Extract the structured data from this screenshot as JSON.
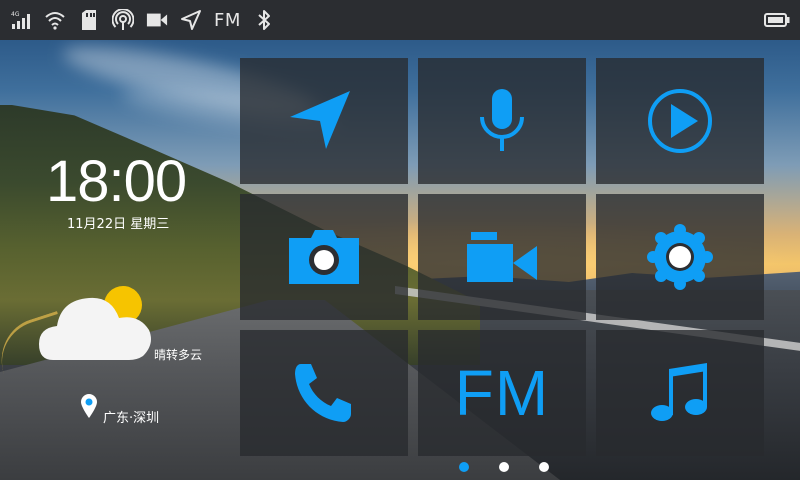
{
  "status_bar": {
    "signal_label": "4G",
    "fm_label": "FM",
    "icons": [
      "signal-4g-icon",
      "wifi-icon",
      "sd-card-icon",
      "hotspot-icon",
      "video-camera-icon",
      "navigation-icon",
      "fm-label",
      "bluetooth-icon",
      "battery-icon"
    ]
  },
  "clock": {
    "time": "18:00",
    "date": "11月22日  星期三"
  },
  "weather": {
    "description": "晴转多云",
    "icon": "partly-cloudy-icon"
  },
  "location": {
    "label": "广东·深圳"
  },
  "tiles": [
    {
      "name": "navigation",
      "icon": "navigation-arrow-icon"
    },
    {
      "name": "voice",
      "icon": "microphone-icon"
    },
    {
      "name": "video-player",
      "icon": "play-icon"
    },
    {
      "name": "camera",
      "icon": "camera-icon"
    },
    {
      "name": "recorder",
      "icon": "video-camera-icon"
    },
    {
      "name": "settings",
      "icon": "gear-icon"
    },
    {
      "name": "phone",
      "icon": "phone-icon"
    },
    {
      "name": "fm-radio",
      "label": "FM"
    },
    {
      "name": "music",
      "icon": "music-note-icon"
    }
  ],
  "pager": {
    "page_count": 3,
    "current_page": 1
  },
  "colors": {
    "accent": "#0f9ef5",
    "statusbar_bg": "#2b2d31",
    "tile_bg": "#2a2c30",
    "weather_sun": "#f6c400"
  }
}
